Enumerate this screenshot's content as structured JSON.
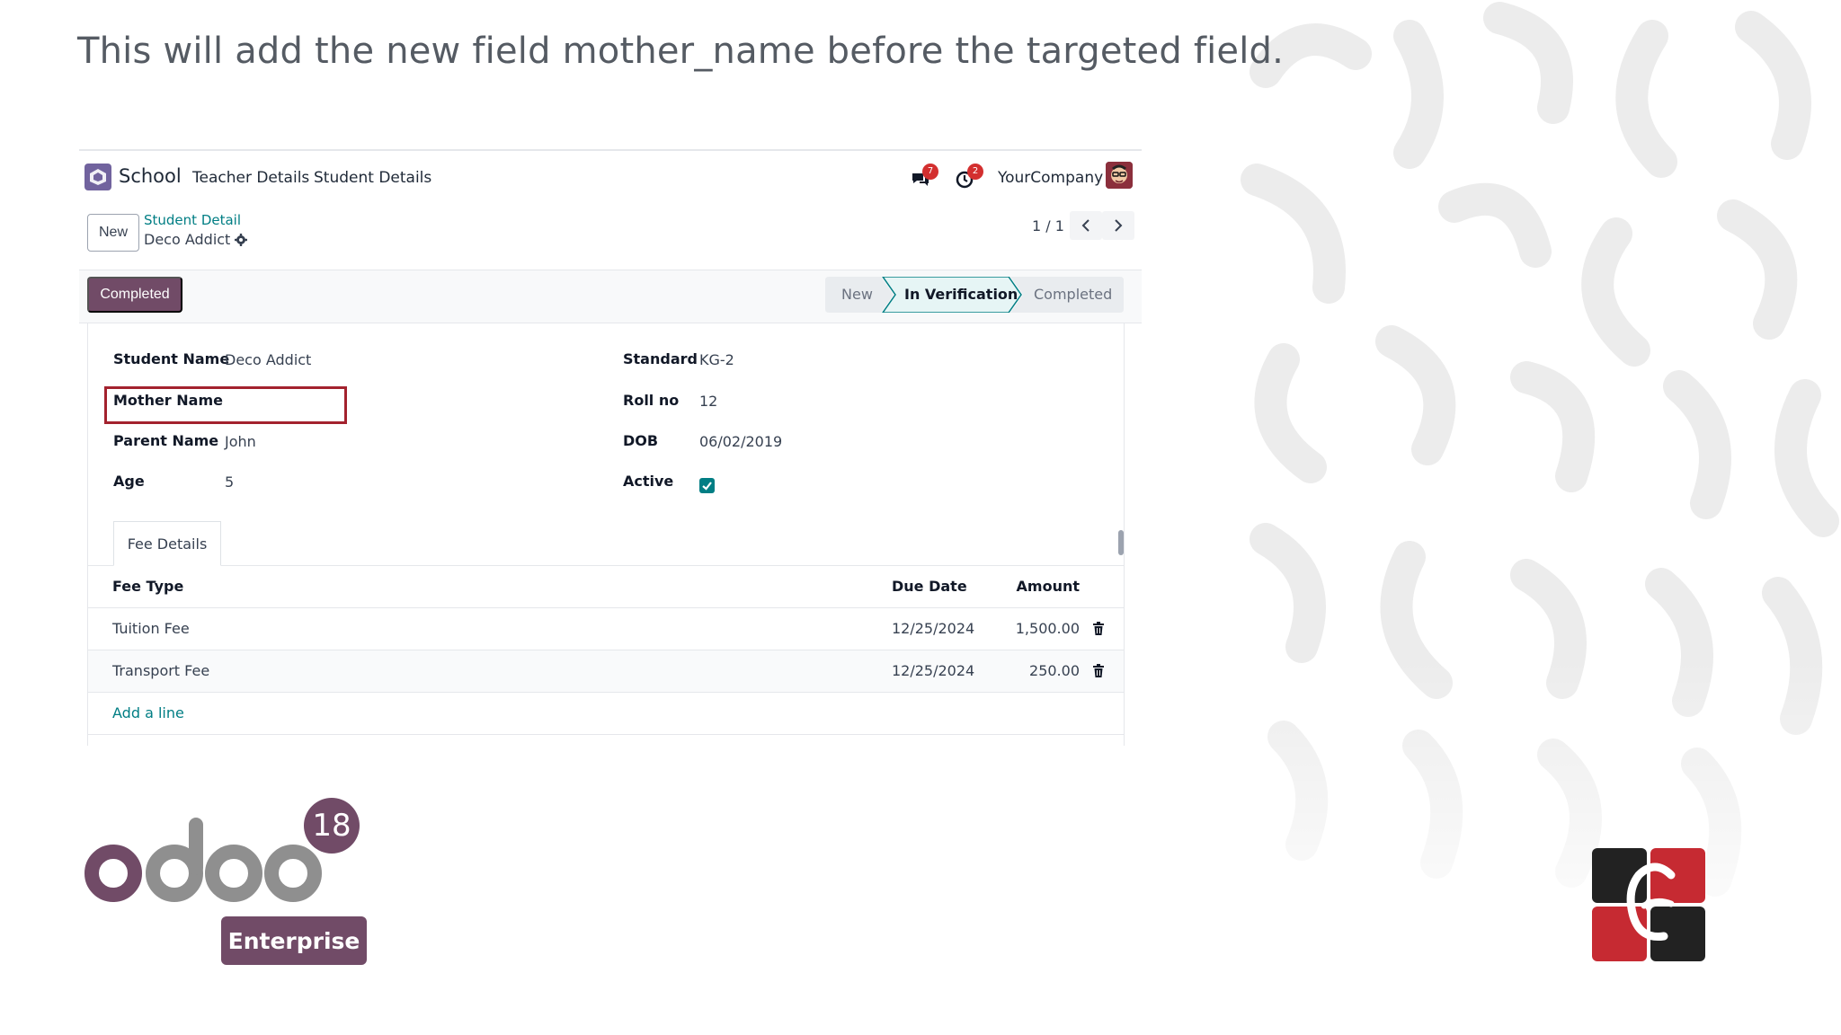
{
  "caption": "This will add the new field mother_name before the targeted field.",
  "navbar": {
    "app_name": "School",
    "menu": [
      "Teacher Details",
      "Student Details"
    ],
    "messages_count": "7",
    "activities_count": "2",
    "company": "YourCompany"
  },
  "controlbar": {
    "new_label": "New",
    "breadcrumb_parent": "Student Detail",
    "breadcrumb_current": "Deco Addict",
    "pager": "1 / 1"
  },
  "statusbar": {
    "action_label": "Completed",
    "stages": [
      {
        "label": "New",
        "active": false
      },
      {
        "label": "In Verification",
        "active": true
      },
      {
        "label": "Completed",
        "active": false
      }
    ]
  },
  "form": {
    "left": [
      {
        "label": "Student Name",
        "value": "Deco Addict"
      },
      {
        "label": "Mother Name",
        "value": ""
      },
      {
        "label": "Parent Name",
        "value": "John"
      },
      {
        "label": "Age",
        "value": "5"
      }
    ],
    "right": [
      {
        "label": "Standard",
        "value": "KG-2"
      },
      {
        "label": "Roll no",
        "value": "12"
      },
      {
        "label": "DOB",
        "value": "06/02/2019"
      },
      {
        "label": "Active",
        "value": ""
      }
    ],
    "active_checked": true
  },
  "fees": {
    "tab_label": "Fee Details",
    "headers": {
      "type": "Fee Type",
      "date": "Due Date",
      "amount": "Amount"
    },
    "rows": [
      {
        "type": "Tuition Fee",
        "date": "12/25/2024",
        "amount": "1,500.00"
      },
      {
        "type": "Transport Fee",
        "date": "12/25/2024",
        "amount": "250.00"
      }
    ],
    "add_line": "Add a line"
  },
  "branding": {
    "odoo_version": "18",
    "edition": "Enterprise",
    "brand_color": "#714b67",
    "accent_color": "#017e84"
  }
}
